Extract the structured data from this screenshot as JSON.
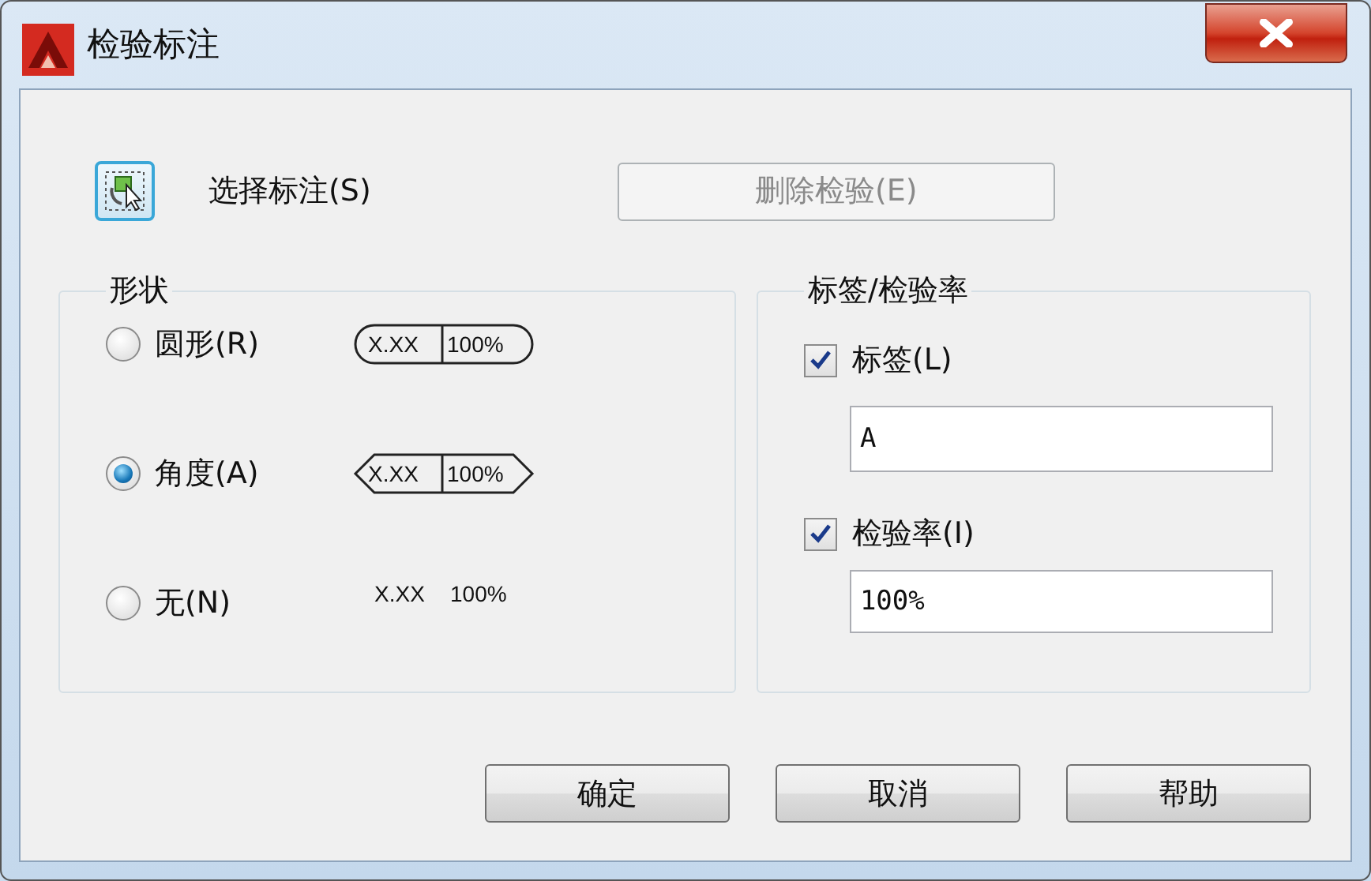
{
  "window": {
    "title": "检验标注"
  },
  "select_dimension": {
    "label": "选择标注(S)"
  },
  "remove_button": {
    "label": "删除检验(E)",
    "disabled": true
  },
  "shape_group": {
    "title": "形状",
    "options": [
      {
        "label": "圆形(R)",
        "kind": "round",
        "selected": false,
        "sample": [
          "X.XX",
          "100%"
        ]
      },
      {
        "label": "角度(A)",
        "kind": "angular",
        "selected": true,
        "sample": [
          "X.XX",
          "100%"
        ]
      },
      {
        "label": "无(N)",
        "kind": "none",
        "selected": false,
        "sample": [
          "X.XX",
          "100%"
        ]
      }
    ]
  },
  "label_group": {
    "title": "标签/检验率",
    "fields": [
      {
        "label": "标签(L)",
        "checked": true,
        "value": "A"
      },
      {
        "label": "检验率(I)",
        "checked": true,
        "value": "100%"
      }
    ]
  },
  "buttons": [
    "确定",
    "取消",
    "帮助"
  ]
}
